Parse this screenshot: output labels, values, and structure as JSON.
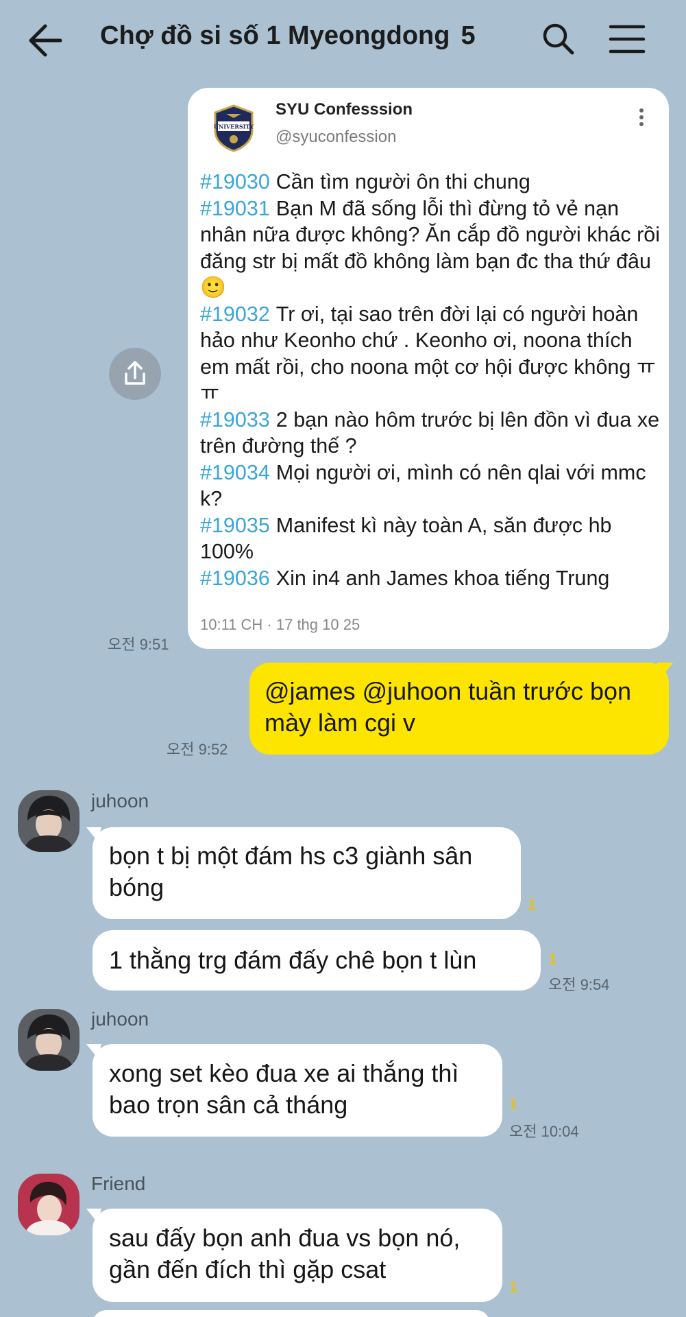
{
  "header": {
    "title": "Chợ đồ si số 1 Myeongdong",
    "member_count": "5",
    "back_icon": "arrow-left-icon",
    "search_icon": "search-icon",
    "menu_icon": "hamburger-menu-icon"
  },
  "shared_post": {
    "account_name": "SYU Confesssion",
    "account_handle": "@syuconfession",
    "logo_text": "UNIVERSITY",
    "entries": [
      {
        "tag": "#19030",
        "text": "Cần tìm người ôn thi chung"
      },
      {
        "tag": "#19031",
        "text": "Bạn M đã sống lỗi thì đừng tỏ vẻ nạn nhân nữa được không? Ăn cắp đồ người khác rồi đăng str bị mất đồ không làm bạn đc tha thứ đâu 🙂"
      },
      {
        "tag": "#19032",
        "text": "Tr ơi, tại sao trên đời lại có người hoàn hảo như Keonho chứ . Keonho ơi, noona thích em mất rồi, cho noona một cơ hội được không ㅠㅠ"
      },
      {
        "tag": "#19033",
        "text": "2 bạn nào hôm trước bị lên đồn vì đua xe trên đường thế ?"
      },
      {
        "tag": "#19034",
        "text": "Mọi người ơi, mình có nên qlai với mmc k?"
      },
      {
        "tag": "#19035",
        "text": "Manifest kì này toàn A, săn được hb 100%"
      },
      {
        "tag": "#19036",
        "text": "Xin in4 anh James khoa tiếng Trung"
      }
    ],
    "post_date": "10:11 CH · 17 thg 10 25",
    "sent_time": "오전 9:51"
  },
  "my_message": {
    "text": "@james @juhoon tuần trước bọn mày làm cgi v",
    "time": "오전 9:52"
  },
  "messages": [
    {
      "sender": "juhoon",
      "text": "bọn t bị một đám hs c3 giành sân bóng",
      "unread": "1"
    },
    {
      "text": "1 thằng trg đám đấy chê bọn t lùn",
      "unread": "1",
      "time": "오전 9:54"
    },
    {
      "sender": "juhoon",
      "text": "xong set kèo đua xe ai thắng thì bao trọn sân cả tháng",
      "unread": "1",
      "time": "오전 10:04"
    },
    {
      "sender": "Friend",
      "text": "sau đấy bọn anh đua vs bọn nó, gần đến đích thì gặp csat",
      "unread": "1"
    }
  ]
}
